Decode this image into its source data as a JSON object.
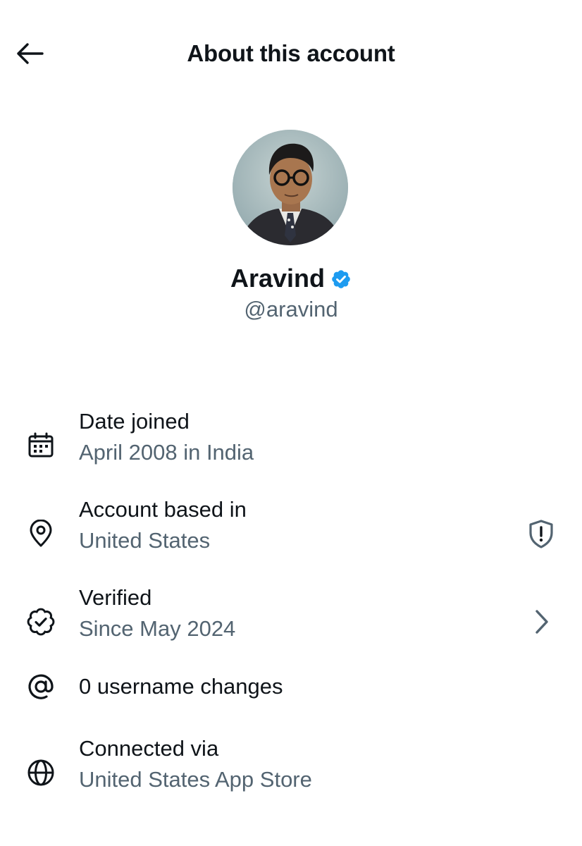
{
  "header": {
    "title": "About this account",
    "back_icon": "arrow-left-icon"
  },
  "profile": {
    "display_name": "Aravind",
    "handle": "@aravind",
    "verified": true,
    "badge_color": "#1d9bf0"
  },
  "details": [
    {
      "icon": "calendar-icon",
      "title": "Date joined",
      "value": "April 2008 in India"
    },
    {
      "icon": "location-pin-icon",
      "title": "Account based in",
      "value": "United States",
      "trailing_icon": "shield-alert-icon"
    },
    {
      "icon": "verified-badge-outline-icon",
      "title": "Verified",
      "value": "Since May 2024",
      "trailing_icon": "chevron-right-icon"
    },
    {
      "icon": "at-sign-icon",
      "title": "0 username changes"
    },
    {
      "icon": "globe-icon",
      "title": "Connected via",
      "value": "United States App Store"
    }
  ],
  "colors": {
    "primary_text": "#0f1419",
    "secondary_text": "#536471",
    "background": "#ffffff"
  }
}
